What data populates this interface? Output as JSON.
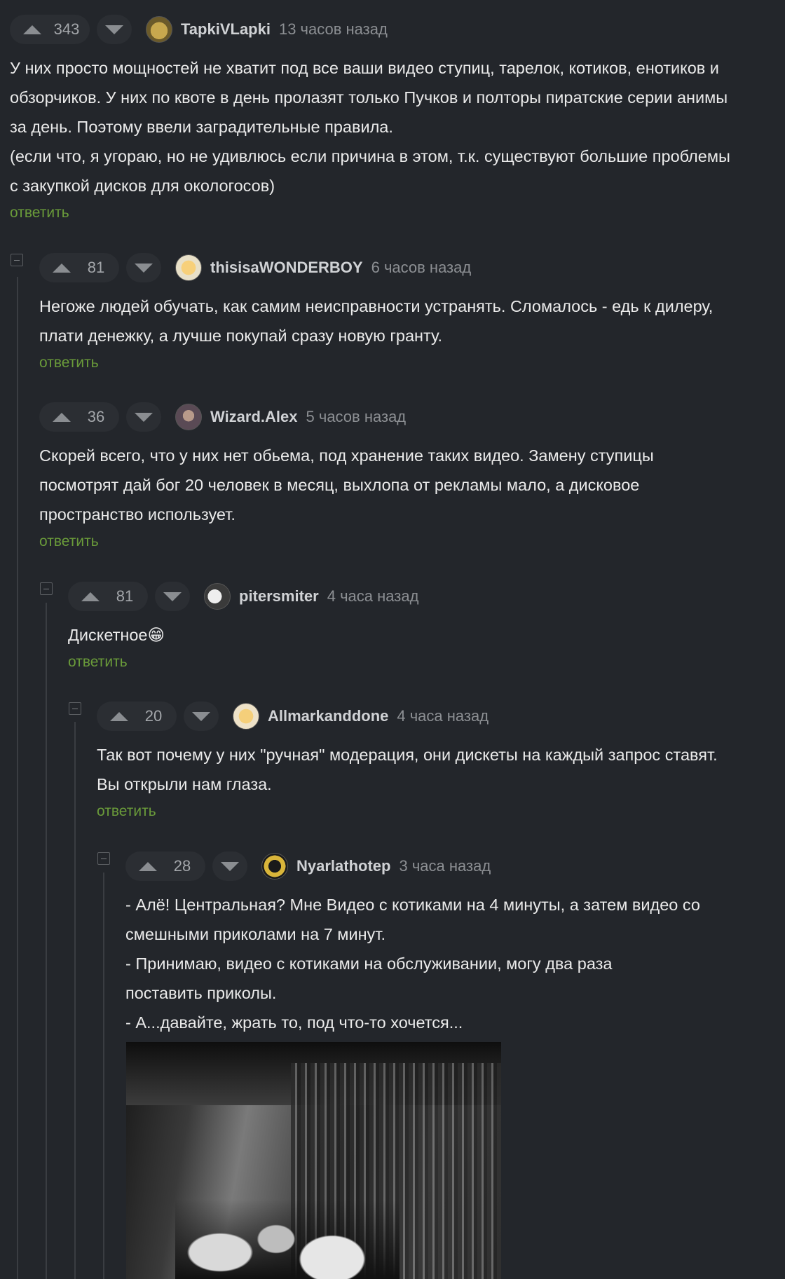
{
  "reply_label": "ответить",
  "comments": [
    {
      "rating": "343",
      "author": "TapkiVLapki",
      "time": "13 часов назад",
      "lines": [
        "У них просто мощностей не хватит под все ваши видео ступиц, тарелок, котиков, енотиков и",
        "обзорчиков. У них по квоте в день пролазят только Пучков и полторы пиратские серии анимы",
        "за день. Поэтому ввели заградительные правила.",
        "(если что, я угораю, но не удивлюсь если причина в этом, т.к. существуют большие проблемы",
        "с закупкой дисков для окологосов)"
      ]
    },
    {
      "rating": "81",
      "author": "thisisaWONDERBOY",
      "time": "6 часов назад",
      "lines": [
        "Негоже людей обучать, как самим неисправности устранять. Сломалось - едь к дилеру,",
        "плати денежку, а лучше покупай сразу новую гранту."
      ]
    },
    {
      "rating": "36",
      "author": "Wizard.Alex",
      "time": "5 часов назад",
      "lines": [
        "Скорей всего, что у них нет обьема, под хранение таких видео. Замену ступицы",
        "посмотрят дай бог 20 человек в месяц, выхлопа от рекламы мало, а дисковое",
        "пространство использует."
      ]
    },
    {
      "rating": "81",
      "author": "pitersmiter",
      "time": "4 часа назад",
      "lines": [
        "Дискетное"
      ],
      "emoji": "😁"
    },
    {
      "rating": "20",
      "author": "Allmarkanddone",
      "time": "4 часа назад",
      "lines": [
        "Так вот почему у них \"ручная\" модерация, они дискеты на каждый запрос ставят.",
        "Вы открыли нам глаза."
      ]
    },
    {
      "rating": "28",
      "author": "Nyarlathotep",
      "time": "3 часа назад",
      "lines": [
        "- Алё! Центральная? Мне Видео с котиками на 4 минуты, а затем видео со",
        "смешными приколами на 7 минут.",
        "- Принимаю, видео с котиками на обслуживании, могу два раза",
        "поставить приколы.",
        "- А...давайте, жрать то, под что-то хочется..."
      ]
    }
  ]
}
